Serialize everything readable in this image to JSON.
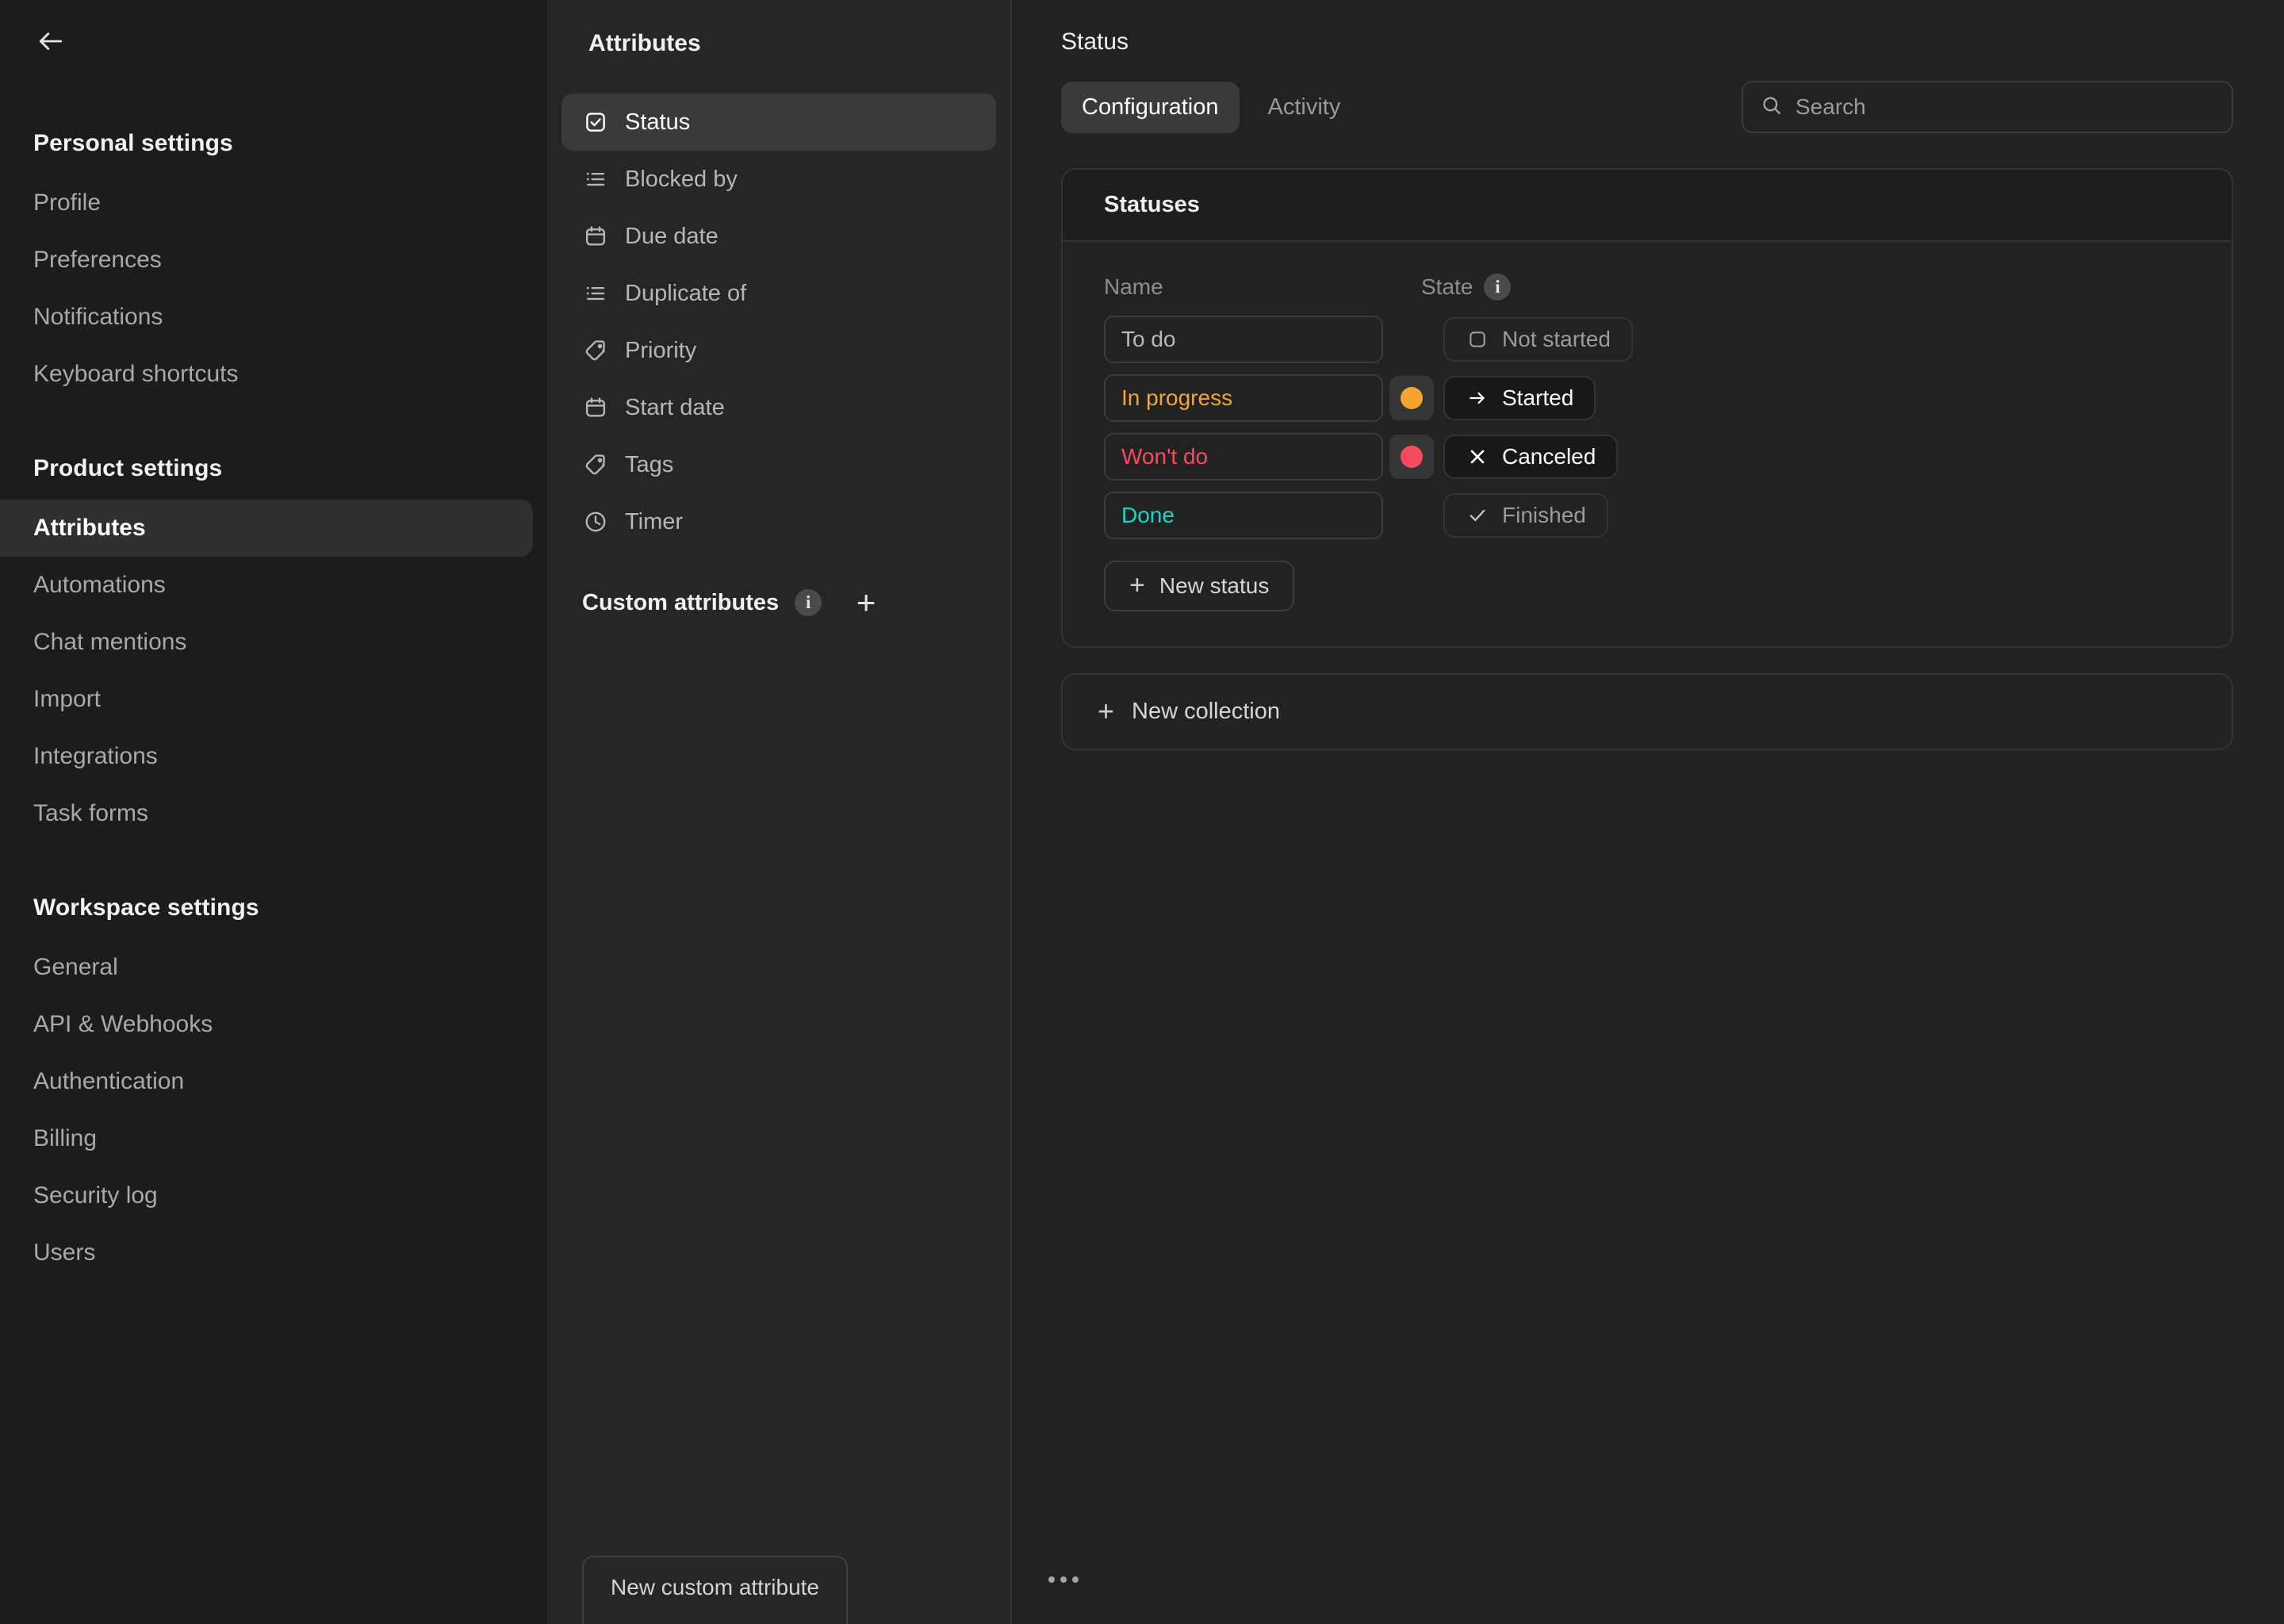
{
  "sidebar": {
    "back_icon": "arrow-left-icon",
    "sections": [
      {
        "title": "Personal settings",
        "items": [
          {
            "label": "Profile",
            "active": false
          },
          {
            "label": "Preferences",
            "active": false
          },
          {
            "label": "Notifications",
            "active": false
          },
          {
            "label": "Keyboard shortcuts",
            "active": false
          }
        ]
      },
      {
        "title": "Product settings",
        "items": [
          {
            "label": "Attributes",
            "active": true
          },
          {
            "label": "Automations",
            "active": false
          },
          {
            "label": "Chat mentions",
            "active": false
          },
          {
            "label": "Import",
            "active": false
          },
          {
            "label": "Integrations",
            "active": false
          },
          {
            "label": "Task forms",
            "active": false
          }
        ]
      },
      {
        "title": "Workspace settings",
        "items": [
          {
            "label": "General",
            "active": false
          },
          {
            "label": "API & Webhooks",
            "active": false
          },
          {
            "label": "Authentication",
            "active": false
          },
          {
            "label": "Billing",
            "active": false
          },
          {
            "label": "Security log",
            "active": false
          },
          {
            "label": "Users",
            "active": false
          }
        ]
      }
    ]
  },
  "attributes_panel": {
    "title": "Attributes",
    "items": [
      {
        "label": "Status",
        "icon": "checkbox-check-icon",
        "active": true
      },
      {
        "label": "Blocked by",
        "icon": "bullet-list-icon",
        "active": false
      },
      {
        "label": "Due date",
        "icon": "calendar-icon",
        "active": false
      },
      {
        "label": "Duplicate of",
        "icon": "bullet-list-icon",
        "active": false
      },
      {
        "label": "Priority",
        "icon": "tag-icon",
        "active": false
      },
      {
        "label": "Start date",
        "icon": "calendar-icon",
        "active": false
      },
      {
        "label": "Tags",
        "icon": "tag-icon",
        "active": false
      },
      {
        "label": "Timer",
        "icon": "clock-icon",
        "active": false
      }
    ],
    "custom_attributes_label": "Custom attributes",
    "custom_attributes_info_icon": "info-icon",
    "custom_attributes_info_char": "i",
    "add_custom_attribute_icon": "plus-icon",
    "add_custom_attribute_char": "+",
    "new_custom_attribute_button": "New custom attribute"
  },
  "main": {
    "title": "Status",
    "tabs": [
      {
        "label": "Configuration",
        "active": true
      },
      {
        "label": "Activity",
        "active": false
      }
    ],
    "search": {
      "icon": "search-icon",
      "placeholder": "Search",
      "value": ""
    },
    "card": {
      "heading": "Statuses",
      "columns": {
        "name": "Name",
        "state": "State",
        "state_info_icon": "info-icon",
        "state_info_char": "i"
      },
      "rows": [
        {
          "name": "To do",
          "name_color": "#b9b9b9",
          "has_swatch": false,
          "swatch_color": "",
          "state_label": "Not started",
          "state_icon": "square-outline-icon",
          "state_emphasis": "muted"
        },
        {
          "name": "In progress",
          "name_color": "#f5a42e",
          "has_swatch": true,
          "swatch_color": "#f5a42e",
          "state_label": "Started",
          "state_icon": "arrow-right-icon",
          "state_emphasis": "strong"
        },
        {
          "name": "Won't do",
          "name_color": "#fa4a5e",
          "has_swatch": true,
          "swatch_color": "#fa4a5e",
          "state_label": "Canceled",
          "state_icon": "x-icon",
          "state_emphasis": "strong"
        },
        {
          "name": "Done",
          "name_color": "#1ad6c4",
          "has_swatch": false,
          "swatch_color": "",
          "state_label": "Finished",
          "state_icon": "check-icon",
          "state_emphasis": "muted"
        }
      ],
      "new_status_button": "New status",
      "new_status_plus": "+"
    },
    "new_collection": {
      "label": "New collection",
      "plus": "+",
      "icon": "plus-icon"
    },
    "overflow_menu_icon": "ellipsis-icon"
  },
  "colors": {
    "bg_sidebar": "#1c1c1c",
    "bg_midpanel": "#262626",
    "bg_main": "#222222",
    "accent_orange": "#f5a42e",
    "accent_red": "#fa4a5e",
    "accent_teal": "#1ad6c4",
    "active_row": "#303030"
  }
}
